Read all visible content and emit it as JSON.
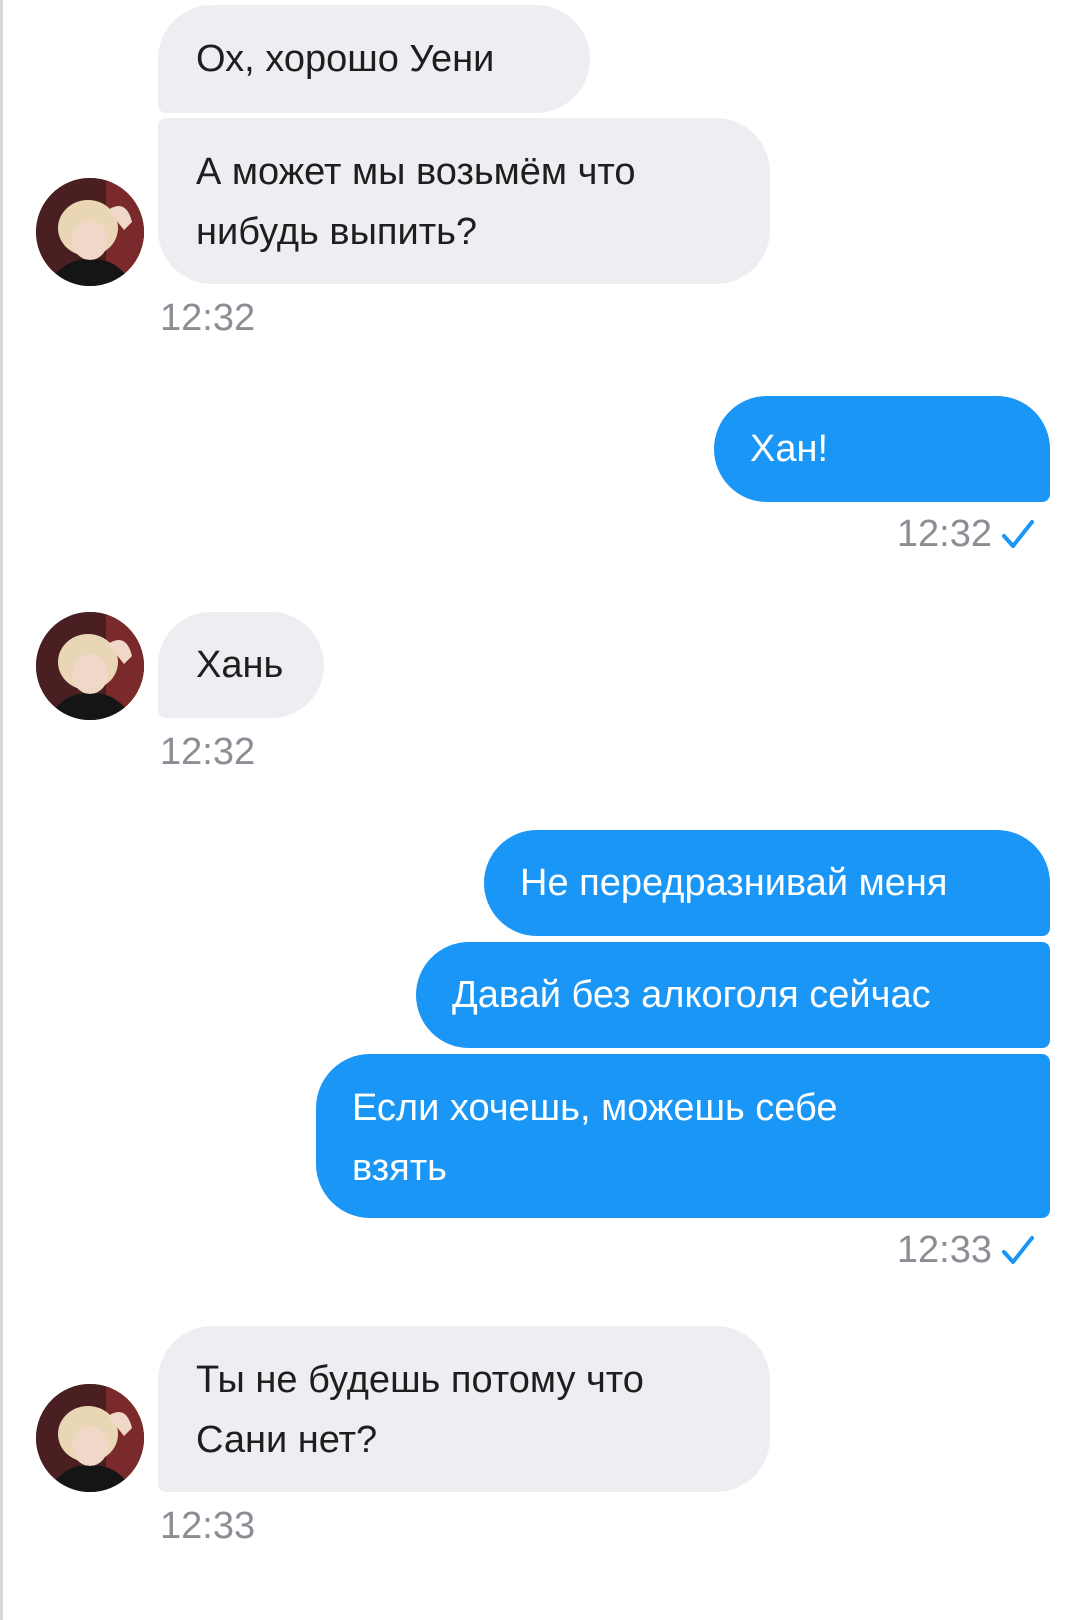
{
  "conversation": {
    "messages": [
      {
        "text": "Ох, хорошо Уени"
      },
      {
        "text": "А может мы возьмём что нибудь выпить?"
      },
      {
        "text": "Хан!"
      },
      {
        "text": "Хань"
      },
      {
        "text": "Не передразнивай меня"
      },
      {
        "text": "Давай без алкоголя сейчас"
      },
      {
        "text": "Если хочешь, можешь себе взять"
      },
      {
        "text": "Ты не будешь потому что Сани нет?"
      }
    ],
    "timestamps": [
      "12:32",
      "12:32",
      "12:32",
      "12:33",
      "12:33"
    ]
  },
  "colors": {
    "incoming_bubble": "#eeeef2",
    "outgoing_bubble": "#1a96f6",
    "timestamp": "#8b8e94",
    "read_check": "#1a96f6"
  },
  "icons": {
    "avatar": "contact-avatar",
    "read_receipt": "check-icon"
  }
}
